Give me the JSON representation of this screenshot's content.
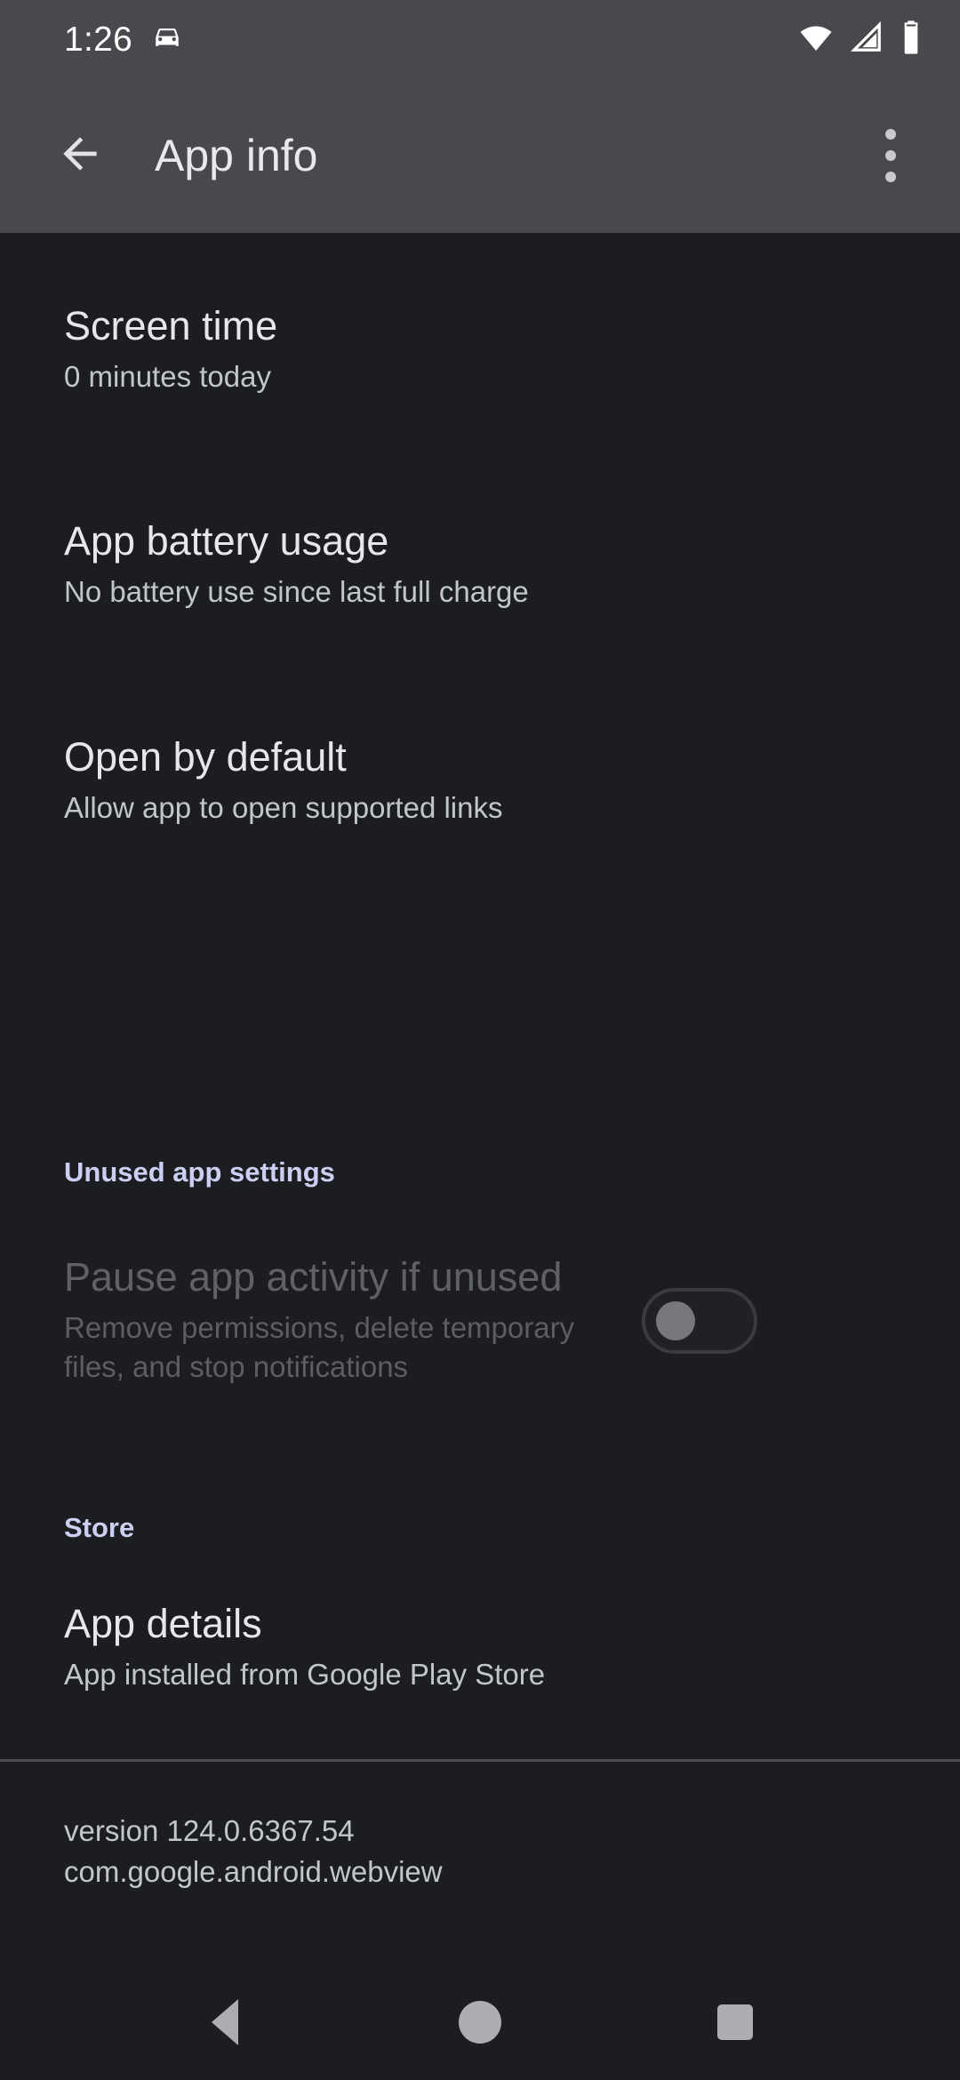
{
  "status_bar": {
    "clock": "1:26",
    "icons": [
      "car-icon",
      "wifi-icon",
      "cellular-signal-icon",
      "battery-icon"
    ]
  },
  "app_bar": {
    "title": "App info",
    "back_icon": "arrow-back-icon",
    "overflow_icon": "more-vert-icon"
  },
  "preferences": [
    {
      "title": "Screen time",
      "summary": "0 minutes today"
    },
    {
      "title": "App battery usage",
      "summary": "No battery use since last full charge"
    },
    {
      "title": "Open by default",
      "summary": "Allow app to open supported links"
    }
  ],
  "unused_section": {
    "header": "Unused app settings",
    "item": {
      "title": "Pause app activity if unused",
      "summary": "Remove permissions, delete temporary files, and stop notifications",
      "switch_state": "off",
      "disabled": true
    }
  },
  "store_section": {
    "header": "Store",
    "item": {
      "title": "App details",
      "summary": "App installed from Google Play Store"
    }
  },
  "footer": {
    "version": "version 124.0.6367.54",
    "package": "com.google.android.webview"
  },
  "nav_bar": {
    "back_label": "back-button",
    "home_label": "home-button",
    "recents_label": "recents-button"
  },
  "colors": {
    "app_bar_background": "#48494D",
    "content_background": "#1C1D21",
    "accent": "#CBCFF2",
    "primary_text": "#E6E7EC",
    "secondary_text": "#C3C5CC",
    "disabled_text": "#5F6166"
  }
}
